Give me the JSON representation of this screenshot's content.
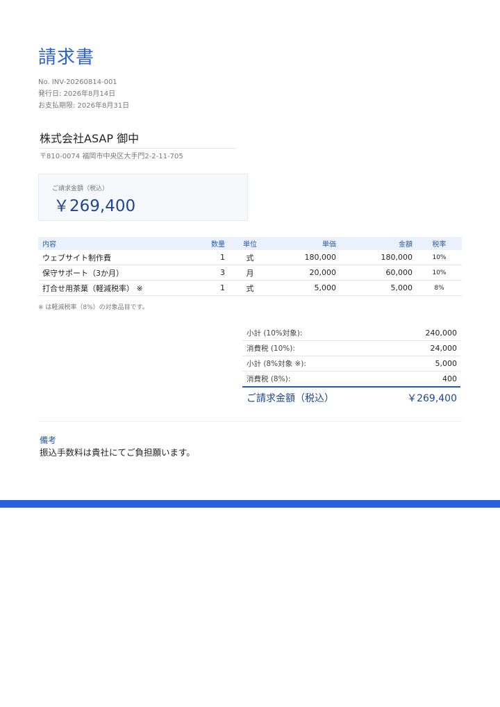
{
  "header": {
    "title": "請求書",
    "invoice_no": "No. INV-20260814-001",
    "issue_date": "発行日: 2026年8月14日",
    "due_date": "お支払期限: 2026年8月31日"
  },
  "client": {
    "name": "株式会社ASAP 御中",
    "address": "〒810-0074 福岡市中央区大手門2-2-11-705"
  },
  "total_box": {
    "label": "ご請求金額（税込）",
    "amount": "￥269,400"
  },
  "items_table": {
    "headers": [
      "内容",
      "数量",
      "単位",
      "単価",
      "金額",
      "税率"
    ],
    "rows": [
      [
        "ウェブサイト制作費",
        "1",
        "式",
        "180,000",
        "180,000",
        "10%"
      ],
      [
        "保守サポート（3か月）",
        "3",
        "月",
        "20,000",
        "60,000",
        "10%"
      ],
      [
        "打合せ用茶葉（軽減税率） ※",
        "1",
        "式",
        "5,000",
        "5,000",
        "8%"
      ]
    ]
  },
  "note": "※ は軽減税率（8%）の対象品目です。",
  "summary": {
    "rows": [
      {
        "label": "小計 (10%対象):",
        "value": "240,000"
      },
      {
        "label": "消費税 (10%):",
        "value": "24,000"
      },
      {
        "label": "小計 (8%対象 ※):",
        "value": "5,000"
      },
      {
        "label": "消費税 (8%):",
        "value": "400"
      }
    ],
    "grand_label": "ご請求金額（税込）",
    "grand_value": "￥269,400"
  },
  "remarks": {
    "title": "備考",
    "body": "振込手数料は貴社にてご負担願います。"
  },
  "colors": {
    "accent": "#2b62d6",
    "dark_accent": "#1e4690",
    "footer_bar": "#2a62de"
  }
}
